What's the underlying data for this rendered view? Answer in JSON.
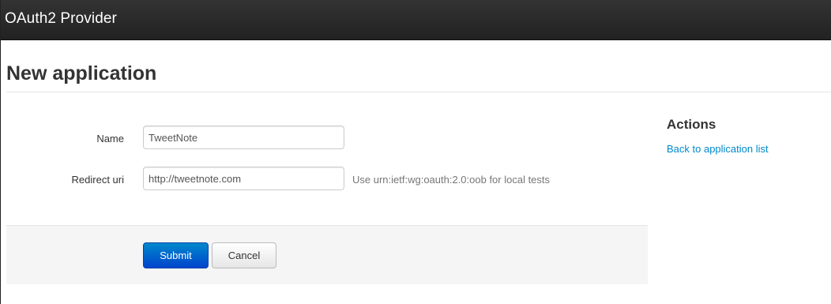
{
  "navbar": {
    "brand": "OAuth2 Provider"
  },
  "page": {
    "title": "New application"
  },
  "form": {
    "name_label": "Name",
    "name_value": "TweetNote",
    "redirect_label": "Redirect uri",
    "redirect_value": "http://tweetnote.com",
    "redirect_help": "Use urn:ietf:wg:oauth:2.0:oob for local tests",
    "submit_label": "Submit",
    "cancel_label": "Cancel"
  },
  "sidebar": {
    "heading": "Actions",
    "back_link": "Back to application list"
  },
  "colors": {
    "navbar": "#222222",
    "primary": "#0088cc",
    "link": "#0088cc"
  }
}
